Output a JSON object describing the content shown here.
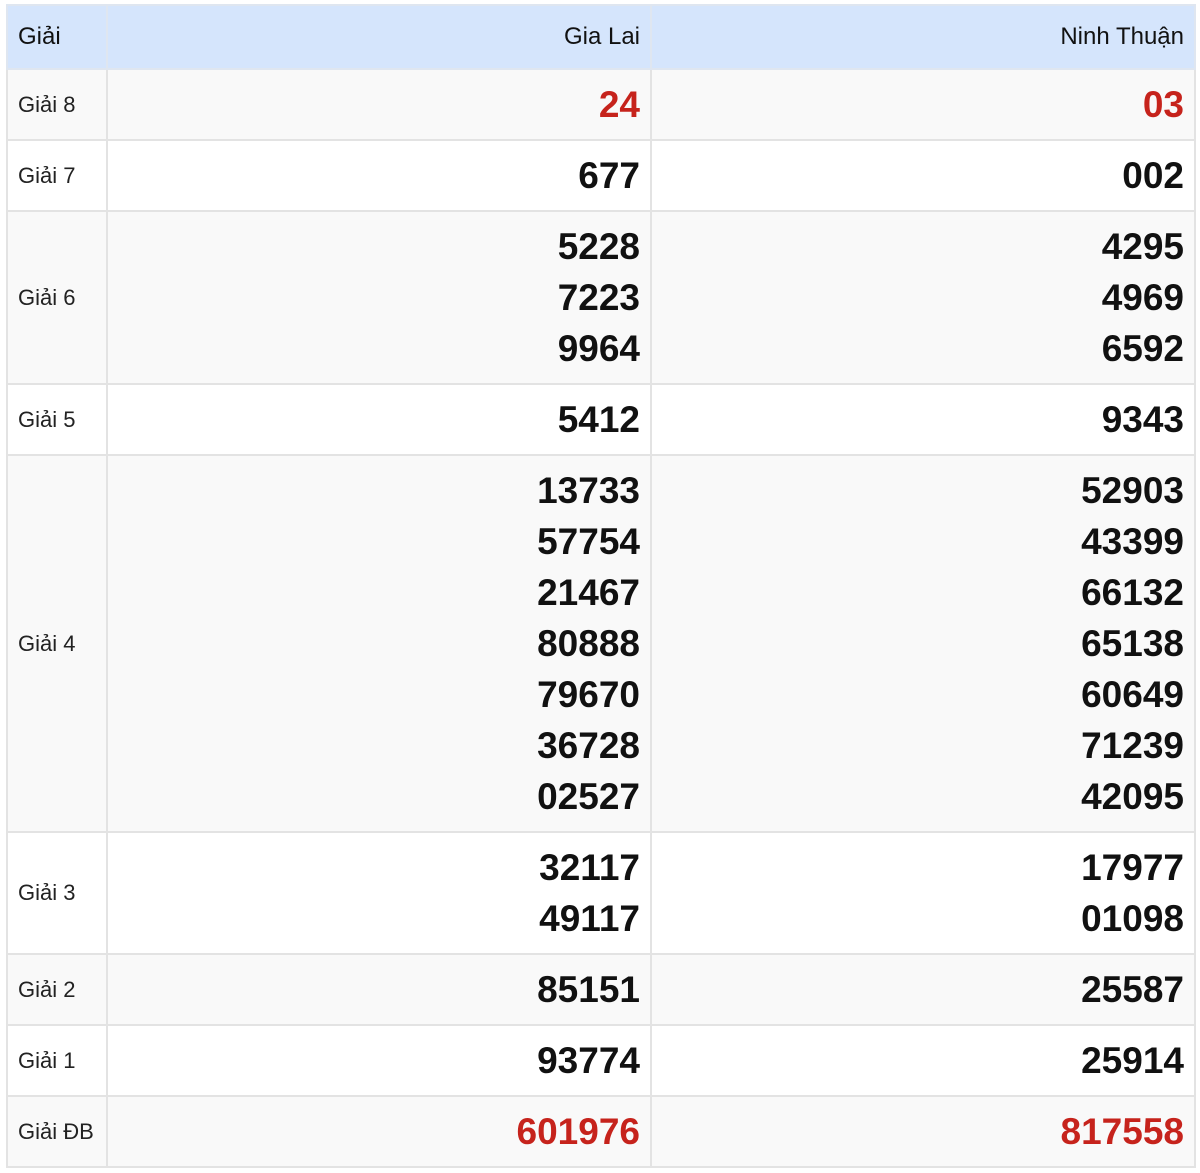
{
  "header": {
    "label": "Giải",
    "provinces": [
      "Gia Lai",
      "Ninh Thuận"
    ]
  },
  "colors": {
    "header_bg": "#d5e5fc",
    "highlight": "#c6231c"
  },
  "rows": [
    {
      "label": "Giải 8",
      "highlight": true,
      "values": [
        [
          "24"
        ],
        [
          "03"
        ]
      ]
    },
    {
      "label": "Giải 7",
      "highlight": false,
      "values": [
        [
          "677"
        ],
        [
          "002"
        ]
      ]
    },
    {
      "label": "Giải 6",
      "highlight": false,
      "values": [
        [
          "5228",
          "7223",
          "9964"
        ],
        [
          "4295",
          "4969",
          "6592"
        ]
      ]
    },
    {
      "label": "Giải 5",
      "highlight": false,
      "values": [
        [
          "5412"
        ],
        [
          "9343"
        ]
      ]
    },
    {
      "label": "Giải 4",
      "highlight": false,
      "values": [
        [
          "13733",
          "57754",
          "21467",
          "80888",
          "79670",
          "36728",
          "02527"
        ],
        [
          "52903",
          "43399",
          "66132",
          "65138",
          "60649",
          "71239",
          "42095"
        ]
      ]
    },
    {
      "label": "Giải 3",
      "highlight": false,
      "values": [
        [
          "32117",
          "49117"
        ],
        [
          "17977",
          "01098"
        ]
      ]
    },
    {
      "label": "Giải 2",
      "highlight": false,
      "values": [
        [
          "85151"
        ],
        [
          "25587"
        ]
      ]
    },
    {
      "label": "Giải 1",
      "highlight": false,
      "values": [
        [
          "93774"
        ],
        [
          "25914"
        ]
      ]
    },
    {
      "label": "Giải ĐB",
      "highlight": true,
      "values": [
        [
          "601976"
        ],
        [
          "817558"
        ]
      ]
    }
  ]
}
